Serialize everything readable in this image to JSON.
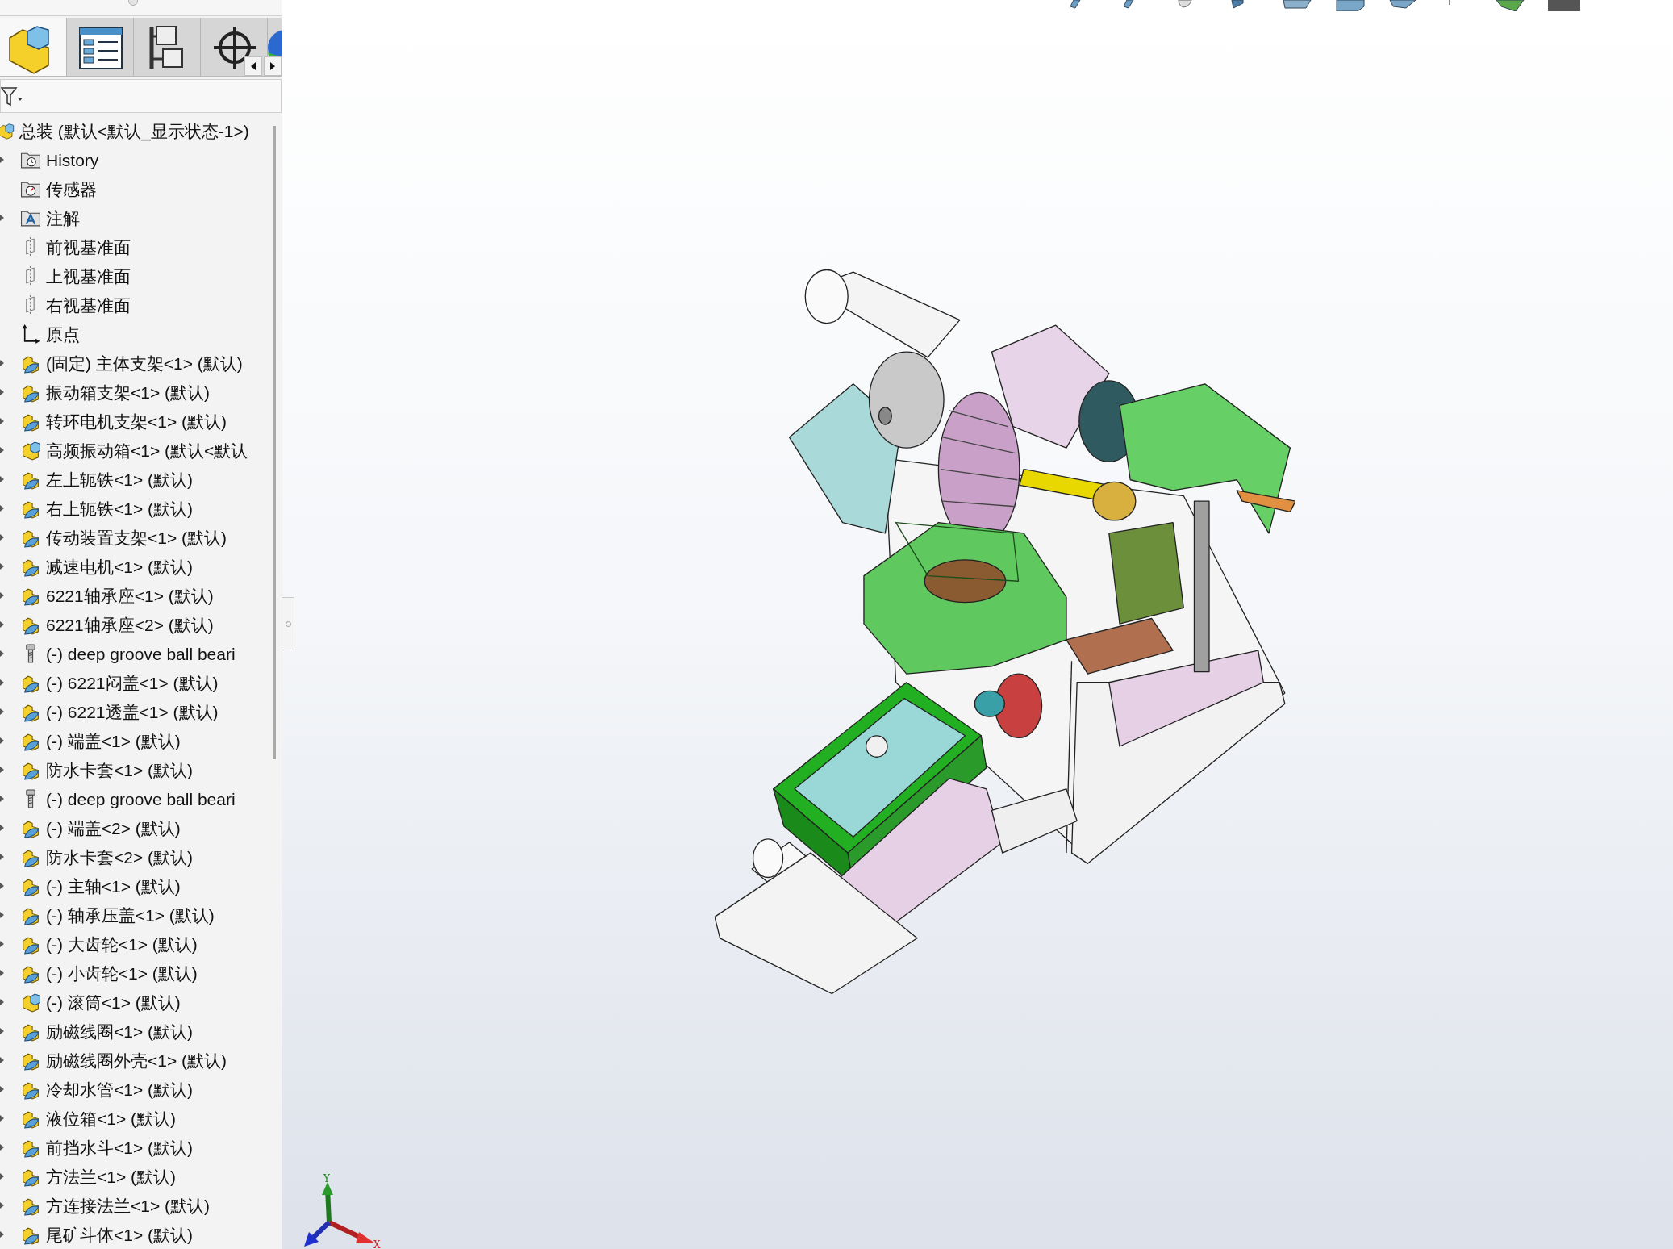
{
  "feature_panel": {
    "tabs": [
      {
        "kind": "feature-tree",
        "selected": true
      },
      {
        "kind": "property",
        "selected": false
      },
      {
        "kind": "configuration",
        "selected": false
      },
      {
        "kind": "crosshair",
        "selected": false
      },
      {
        "kind": "display",
        "selected": false
      }
    ]
  },
  "feature_tree": {
    "root": {
      "label": "总装 (默认<默认_显示状态-1>)",
      "kind": "assembly",
      "children": [
        {
          "label": "History",
          "kind": "history",
          "expandable": true
        },
        {
          "label": "传感器",
          "kind": "sensor",
          "expandable": false
        },
        {
          "label": "注解",
          "kind": "annotation",
          "expandable": true
        },
        {
          "label": "前视基准面",
          "kind": "plane",
          "expandable": false
        },
        {
          "label": "上视基准面",
          "kind": "plane",
          "expandable": false
        },
        {
          "label": "右视基准面",
          "kind": "plane",
          "expandable": false
        },
        {
          "label": "原点",
          "kind": "origin",
          "expandable": false
        },
        {
          "label": "(固定) 主体支架<1> (默认)",
          "kind": "part",
          "expandable": true
        },
        {
          "label": "振动箱支架<1> (默认)",
          "kind": "part",
          "expandable": true
        },
        {
          "label": "转环电机支架<1> (默认)",
          "kind": "part",
          "expandable": true
        },
        {
          "label": "高频振动箱<1> (默认<默认",
          "kind": "assembly",
          "expandable": true
        },
        {
          "label": "左上轭铁<1> (默认)",
          "kind": "part",
          "expandable": true
        },
        {
          "label": "右上轭铁<1> (默认)",
          "kind": "part",
          "expandable": true
        },
        {
          "label": "传动装置支架<1> (默认)",
          "kind": "part",
          "expandable": true
        },
        {
          "label": "减速电机<1> (默认)",
          "kind": "part",
          "expandable": true
        },
        {
          "label": "6221轴承座<1> (默认)",
          "kind": "part",
          "expandable": true
        },
        {
          "label": "6221轴承座<2> (默认)",
          "kind": "part",
          "expandable": true
        },
        {
          "label": "(-) deep groove ball beari",
          "kind": "toolbox",
          "expandable": true
        },
        {
          "label": "(-) 6221闷盖<1> (默认)",
          "kind": "part",
          "expandable": true
        },
        {
          "label": "(-) 6221透盖<1> (默认)",
          "kind": "part",
          "expandable": true
        },
        {
          "label": "(-) 端盖<1> (默认)",
          "kind": "part",
          "expandable": true
        },
        {
          "label": "防水卡套<1> (默认)",
          "kind": "part",
          "expandable": true
        },
        {
          "label": "(-) deep groove ball beari",
          "kind": "toolbox",
          "expandable": true
        },
        {
          "label": "(-) 端盖<2> (默认)",
          "kind": "part",
          "expandable": true
        },
        {
          "label": "防水卡套<2> (默认)",
          "kind": "part",
          "expandable": true
        },
        {
          "label": "(-) 主轴<1> (默认)",
          "kind": "part",
          "expandable": true
        },
        {
          "label": "(-) 轴承压盖<1> (默认)",
          "kind": "part",
          "expandable": true
        },
        {
          "label": "(-) 大齿轮<1> (默认)",
          "kind": "part",
          "expandable": true
        },
        {
          "label": "(-) 小齿轮<1> (默认)",
          "kind": "part",
          "expandable": true
        },
        {
          "label": "(-) 滚筒<1> (默认)",
          "kind": "assembly",
          "expandable": true
        },
        {
          "label": "励磁线圈<1> (默认)",
          "kind": "part",
          "expandable": true
        },
        {
          "label": "励磁线圈外壳<1> (默认)",
          "kind": "part",
          "expandable": true
        },
        {
          "label": "冷却水管<1> (默认)",
          "kind": "part",
          "expandable": true
        },
        {
          "label": "液位箱<1> (默认)",
          "kind": "part",
          "expandable": true
        },
        {
          "label": "前挡水斗<1> (默认)",
          "kind": "part",
          "expandable": true
        },
        {
          "label": "方法兰<1> (默认)",
          "kind": "part",
          "expandable": true
        },
        {
          "label": "方连接法兰<1> (默认)",
          "kind": "part",
          "expandable": true
        },
        {
          "label": "尾矿斗体<1> (默认)",
          "kind": "part",
          "expandable": true
        }
      ]
    }
  },
  "triad": {
    "y_label": "Y",
    "x_label": "X"
  }
}
